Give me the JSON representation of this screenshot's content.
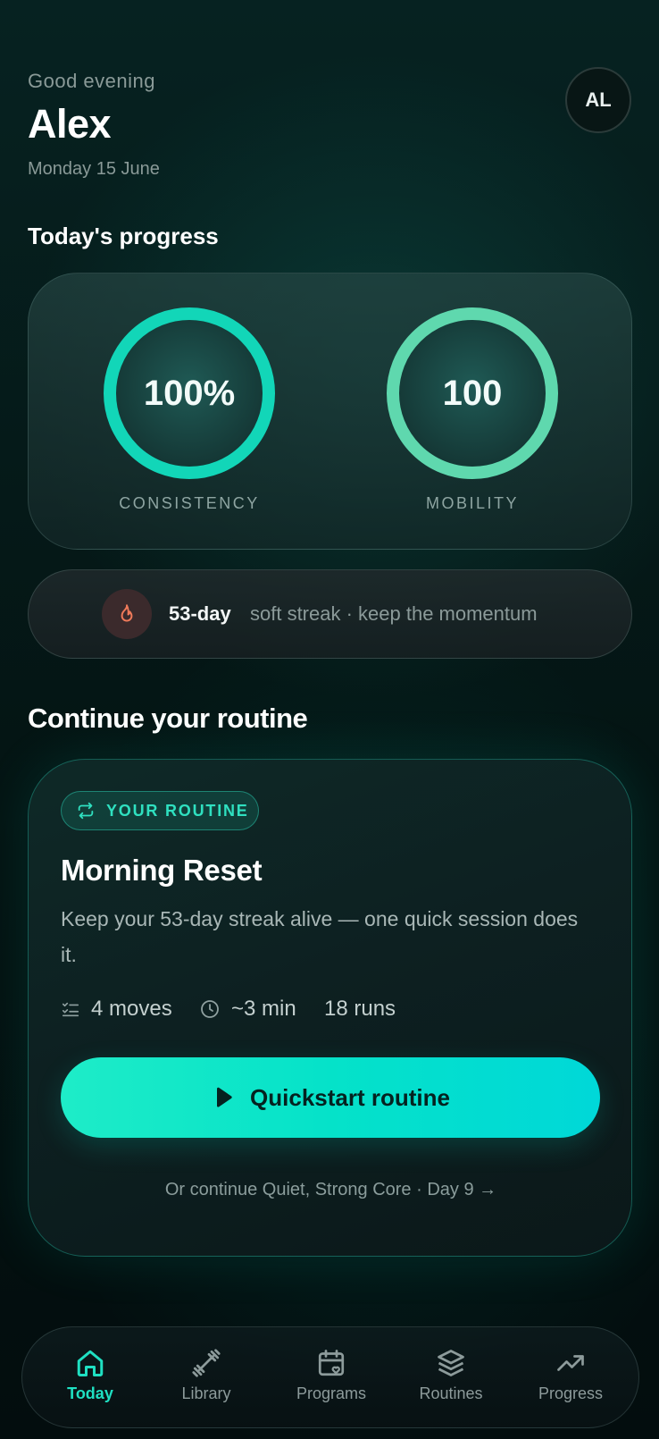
{
  "header": {
    "greeting": "Good evening",
    "name": "Alex",
    "date": "Monday 15 June",
    "avatar_initials": "AL"
  },
  "progress": {
    "title": "Today's progress",
    "rings": [
      {
        "value_text": "100%",
        "label": "CONSISTENCY",
        "percent": 100,
        "color": "#12d6b8"
      },
      {
        "value_text": "100",
        "label": "MOBILITY",
        "percent": 100,
        "color": "#5fd8ae"
      }
    ]
  },
  "streak": {
    "bold": "53-day",
    "text": "soft streak · keep the momentum",
    "icon": "flame-icon",
    "icon_color": "#f07a5a"
  },
  "routine_section": {
    "title": "Continue your routine",
    "badge": "YOUR ROUTINE",
    "routine_title": "Morning Reset",
    "description": "Keep your 53-day streak alive — one quick session does it.",
    "meta": {
      "moves": "4 moves",
      "duration": "~3 min",
      "runs": "18 runs"
    },
    "button_label": "Quickstart routine",
    "continue_link": "Or continue Quiet, Strong Core · Day 9 →"
  },
  "nav": {
    "items": [
      {
        "label": "Today",
        "icon": "home-icon",
        "active": true
      },
      {
        "label": "Library",
        "icon": "dumbbell-icon",
        "active": false
      },
      {
        "label": "Programs",
        "icon": "calendar-heart-icon",
        "active": false
      },
      {
        "label": "Routines",
        "icon": "layers-icon",
        "active": false
      },
      {
        "label": "Progress",
        "icon": "trending-up-icon",
        "active": false
      }
    ]
  },
  "colors": {
    "accent": "#1fe0c2",
    "background": "#041312"
  }
}
